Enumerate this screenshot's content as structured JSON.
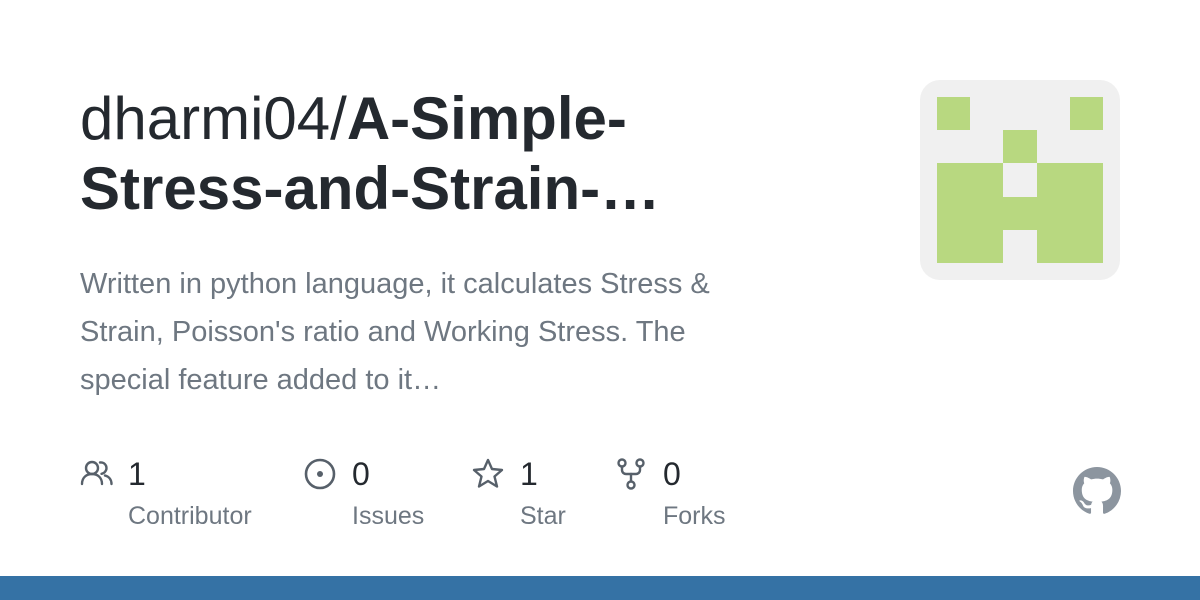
{
  "repo": {
    "owner": "dharmi04/",
    "name_line1": "A-Simple-",
    "name_line2": "Stress-and-Strain-…",
    "description_line1": "Written in python language, it calculates Stress &",
    "description_line2": "Strain, Poisson's ratio and Working Stress. The",
    "description_line3": "special feature added to it…"
  },
  "stats": [
    {
      "icon": "people-icon",
      "value": "1",
      "label": "Contributor"
    },
    {
      "icon": "issue-icon",
      "value": "0",
      "label": "Issues"
    },
    {
      "icon": "star-icon",
      "value": "1",
      "label": "Star"
    },
    {
      "icon": "fork-icon",
      "value": "0",
      "label": "Forks"
    }
  ],
  "colors": {
    "avatar_green": "#b8d880",
    "avatar_bg": "#f0f0f0",
    "language_bar": "#3572A5",
    "icon_gray": "#57606a",
    "github_logo": "#8c959f"
  }
}
